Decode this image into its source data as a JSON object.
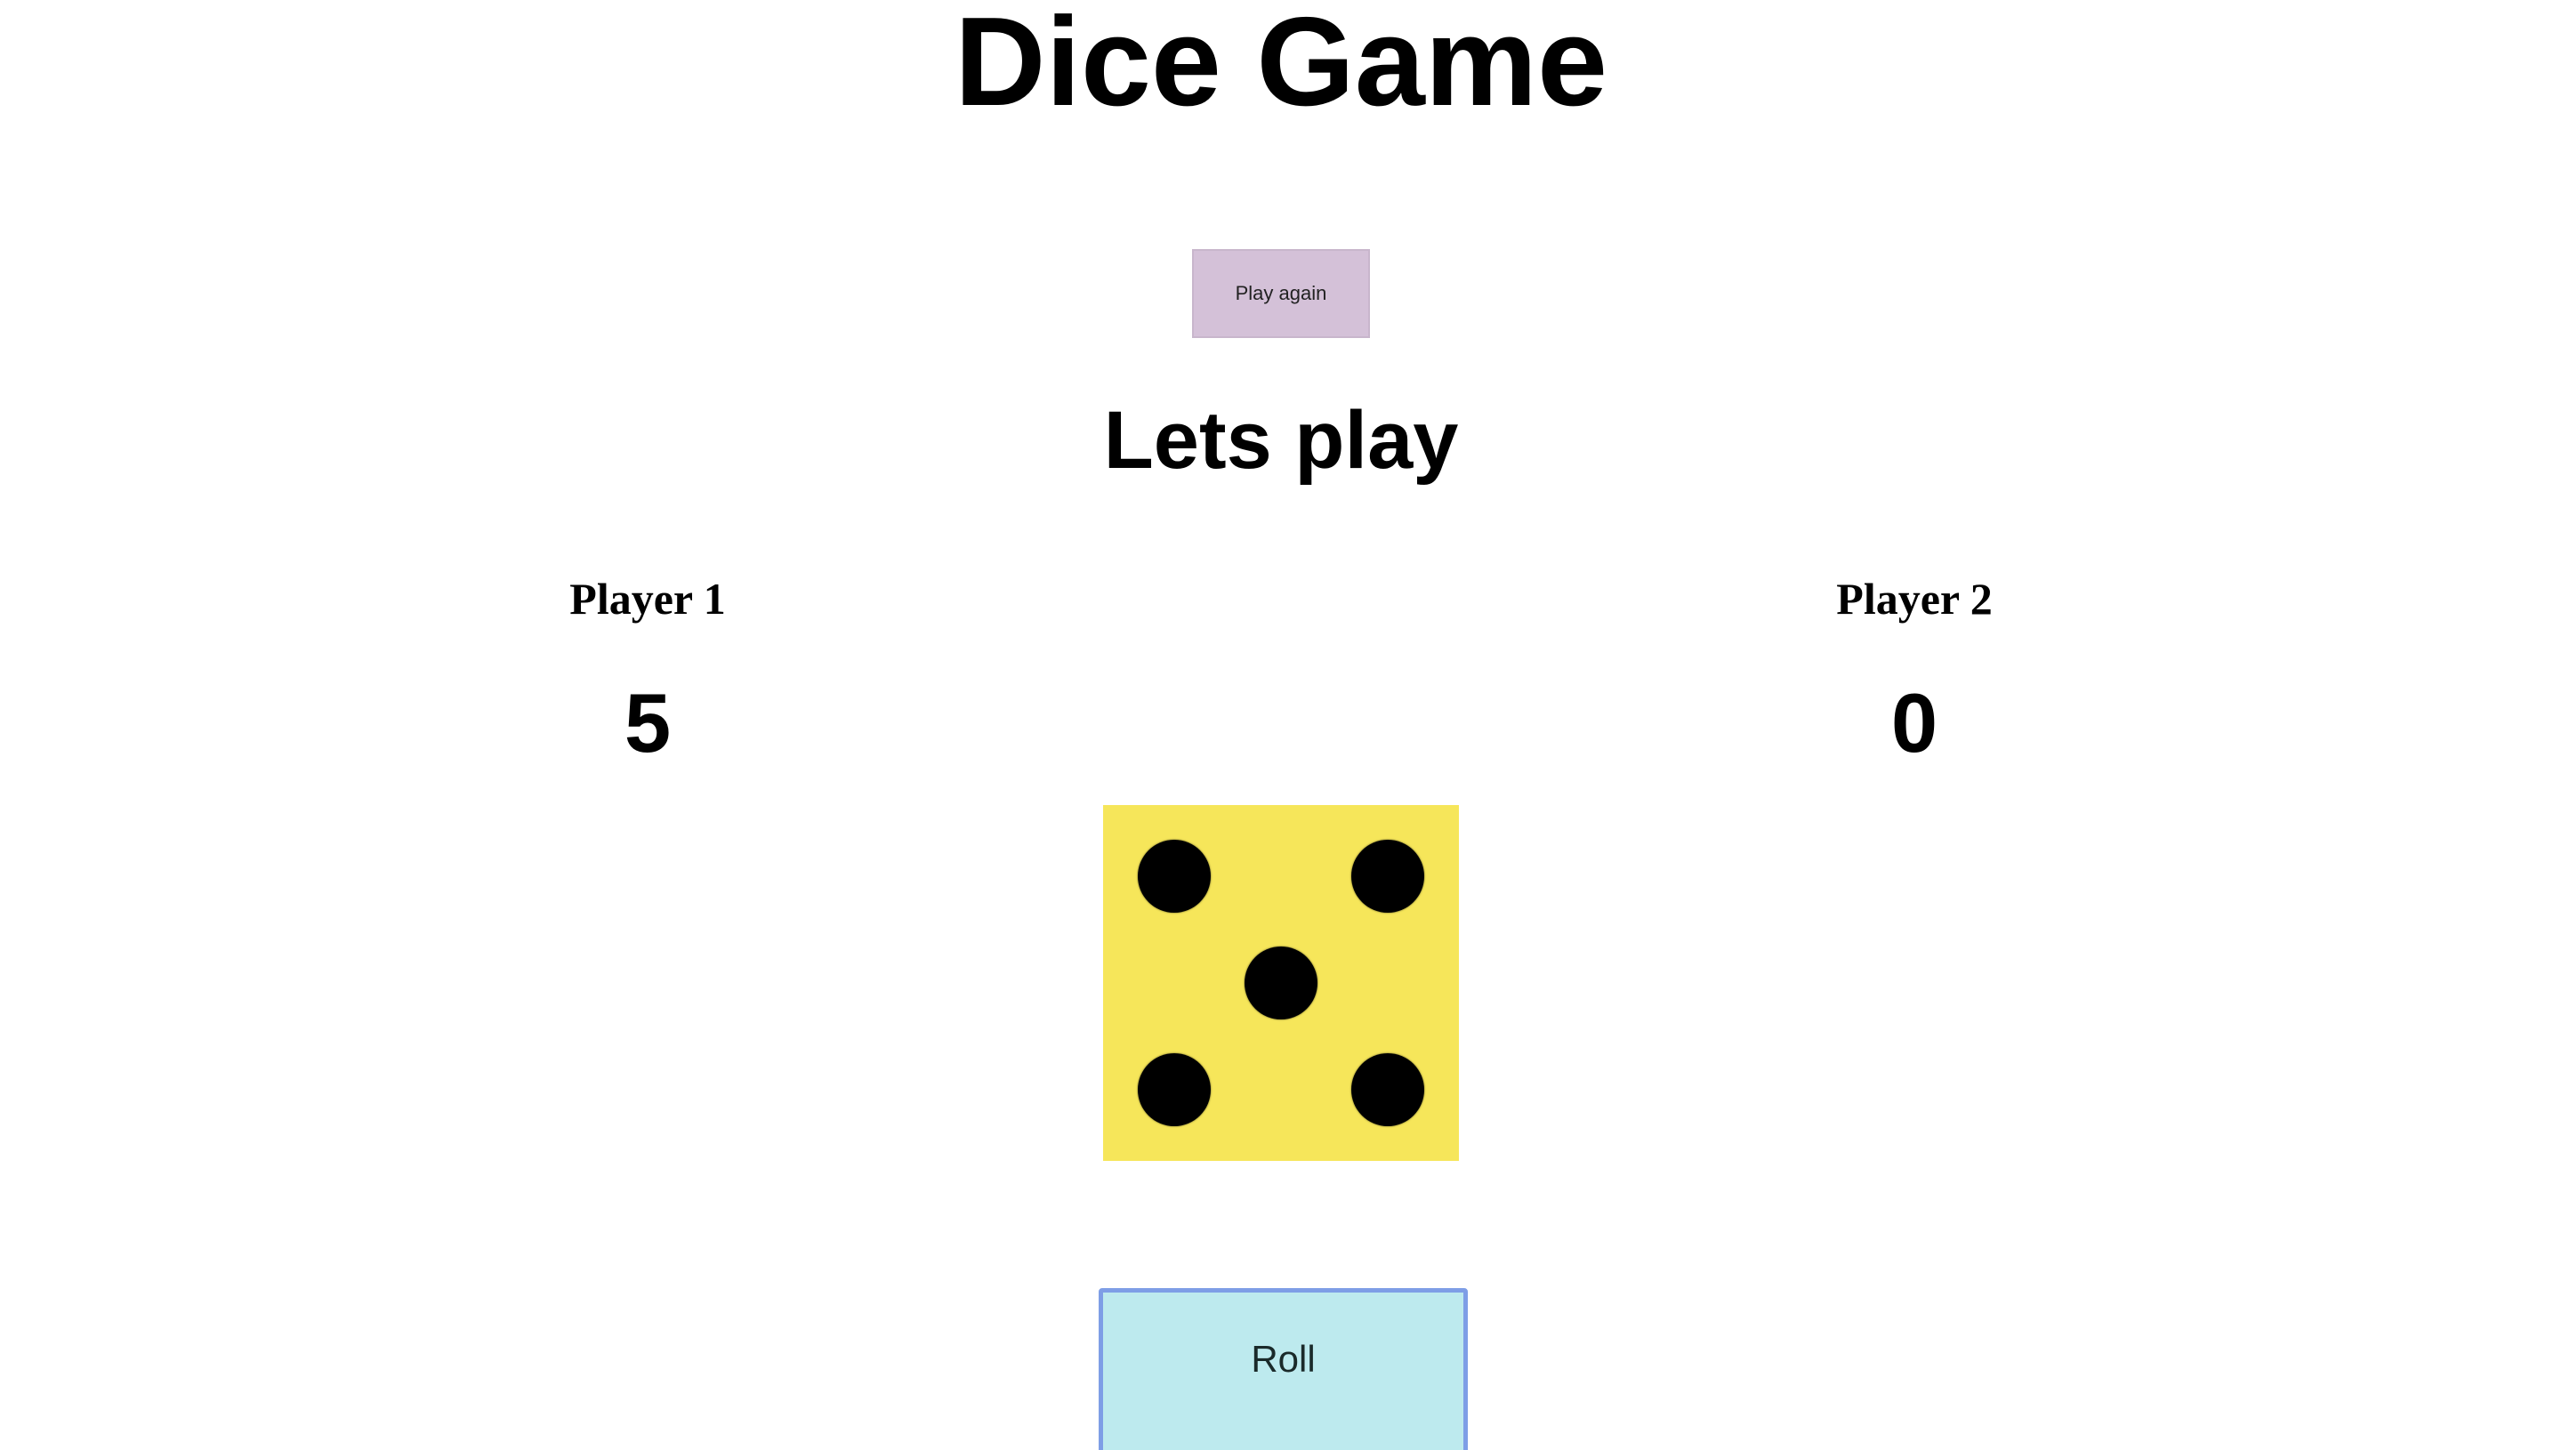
{
  "header": {
    "title": "Dice Game"
  },
  "controls": {
    "play_again_label": "Play again",
    "roll_label": "Roll"
  },
  "status": {
    "message": "Lets play"
  },
  "players": [
    {
      "name": "Player 1",
      "score": "5"
    },
    {
      "name": "Player 2",
      "score": "0"
    }
  ],
  "die": {
    "value": 5,
    "pip_icon": "dice-five-icon"
  },
  "colors": {
    "play_again_bg": "#d4c1d8",
    "die_face": "#f6e65a",
    "pip": "#000000",
    "roll_bg": "#bdeaee",
    "roll_border": "#7e9ee6"
  }
}
